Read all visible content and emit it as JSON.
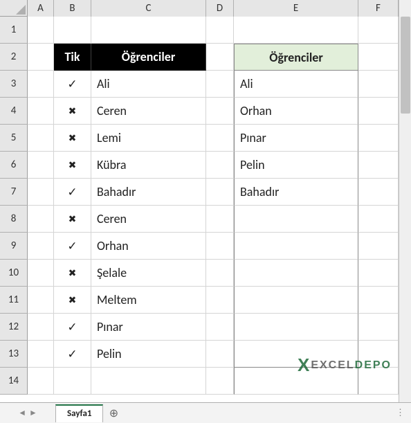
{
  "columns": [
    "A",
    "B",
    "C",
    "D",
    "E",
    "F"
  ],
  "row_count": 14,
  "headers": {
    "tik": "Tik",
    "ogrenciler_left": "Öğrenciler",
    "ogrenciler_right": "Öğrenciler"
  },
  "marks": {
    "check": "✓",
    "cross": "✖"
  },
  "table_left": [
    {
      "tik": "check",
      "name": "Ali"
    },
    {
      "tik": "cross",
      "name": "Ceren"
    },
    {
      "tik": "cross",
      "name": "Lemi"
    },
    {
      "tik": "cross",
      "name": "Kübra"
    },
    {
      "tik": "check",
      "name": "Bahadır"
    },
    {
      "tik": "cross",
      "name": "Ceren"
    },
    {
      "tik": "check",
      "name": "Orhan"
    },
    {
      "tik": "cross",
      "name": "Şelale"
    },
    {
      "tik": "cross",
      "name": "Meltem"
    },
    {
      "tik": "check",
      "name": "Pınar"
    },
    {
      "tik": "check",
      "name": "Pelin"
    }
  ],
  "table_right": [
    "Ali",
    "Orhan",
    "Pınar",
    "Pelin",
    "Bahadır"
  ],
  "sheet_tab": "Sayfa1",
  "watermark": {
    "brand_prefix": "EXCEL",
    "brand_suffix": "DEPO"
  },
  "chart_data": {
    "type": "table",
    "title": "Öğrenciler",
    "columns": [
      "Tik",
      "Öğrenciler"
    ],
    "rows": [
      [
        "✓",
        "Ali"
      ],
      [
        "✖",
        "Ceren"
      ],
      [
        "✖",
        "Lemi"
      ],
      [
        "✖",
        "Kübra"
      ],
      [
        "✓",
        "Bahadır"
      ],
      [
        "✖",
        "Ceren"
      ],
      [
        "✓",
        "Orhan"
      ],
      [
        "✖",
        "Şelale"
      ],
      [
        "✖",
        "Meltem"
      ],
      [
        "✓",
        "Pınar"
      ],
      [
        "✓",
        "Pelin"
      ]
    ],
    "filtered_column_header": "Öğrenciler",
    "filtered_values": [
      "Ali",
      "Orhan",
      "Pınar",
      "Pelin",
      "Bahadır"
    ]
  }
}
